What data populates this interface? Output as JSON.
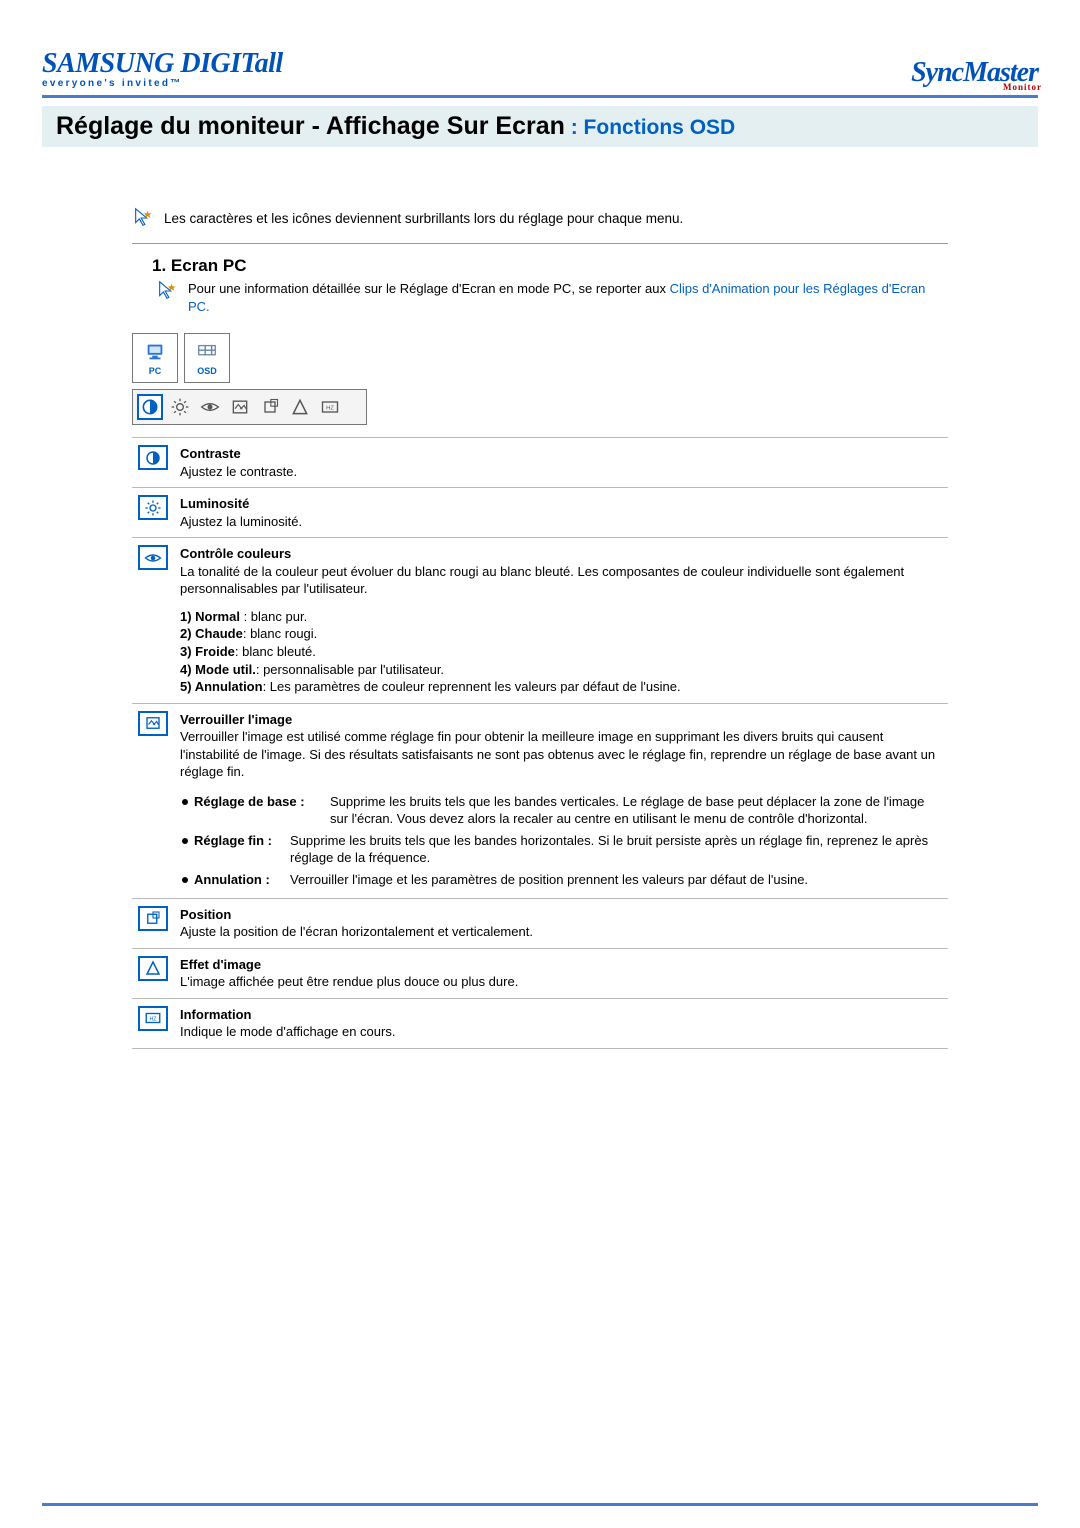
{
  "header": {
    "brand1": "SAMSUNG DIGITall",
    "tagline": "everyone's invited™",
    "brand2": "SyncMaster",
    "brand2_sub": "Monitor"
  },
  "title": {
    "main": "Réglage du moniteur -  Affichage Sur Ecran",
    "sub": " : Fonctions OSD"
  },
  "intro": "Les caractères et les icônes deviennent surbrillants lors du réglage pour chaque menu.",
  "section1": {
    "heading": "1. Ecran PC",
    "intro_before": "Pour une information détaillée sur le Réglage d'Ecran en mode PC, se reporter aux ",
    "link": "Clips d'Animation pour les Réglages d'Ecran PC.",
    "tab_pc": "PC",
    "tab_osd": "OSD"
  },
  "rows": {
    "contrast": {
      "title": "Contraste",
      "desc": "Ajustez le contraste."
    },
    "brightness": {
      "title": "Luminosité",
      "desc": "Ajustez la luminosité."
    },
    "color": {
      "title": "Contrôle couleurs",
      "desc": "La tonalité de la couleur peut évoluer du blanc rougi au blanc bleuté. Les composantes de couleur individuelle sont également personnalisables par l'utilisateur.",
      "l1_b": "1) Normal",
      "l1_t": " : blanc pur.",
      "l2_b": "2) Chaude",
      "l2_t": ": blanc rougi.",
      "l3_b": "3) Froide",
      "l3_t": ": blanc bleuté.",
      "l4_b": "4) Mode util.",
      "l4_t": ": personnalisable par l'utilisateur.",
      "l5_b": "5) Annulation",
      "l5_t": ": Les paramètres de couleur reprennent les valeurs par défaut de l'usine."
    },
    "lock": {
      "title": "Verrouiller l'image",
      "desc": "Verrouiller l'image est utilisé comme réglage fin pour obtenir la meilleure image en supprimant les divers bruits qui causent l'instabilité de l'image. Si des résultats satisfaisants ne sont pas obtenus avec le réglage fin, reprendre un réglage de base avant un réglage fin.",
      "s1_l": "Réglage de base :",
      "s1_t": "Supprime les bruits tels que les bandes verticales. Le réglage de base peut déplacer la zone de l'image sur l'écran. Vous devez alors la recaler au centre en utilisant le menu de contrôle d'horizontal.",
      "s2_l": "Réglage fin :",
      "s2_t": "Supprime les bruits tels que les bandes horizontales. Si le bruit persiste après un réglage fin, reprenez le après réglage de la fréquence.",
      "s3_l": "Annulation :",
      "s3_t": "Verrouiller l'image et les paramètres de position prennent les valeurs par défaut de l'usine."
    },
    "position": {
      "title": "Position",
      "desc": "Ajuste la position de l'écran horizontalement et verticalement."
    },
    "effect": {
      "title": "Effet d'image",
      "desc": "L'image affichée peut être rendue plus douce ou plus dure."
    },
    "info": {
      "title": "Information",
      "desc": "Indique le mode d'affichage en cours."
    }
  }
}
